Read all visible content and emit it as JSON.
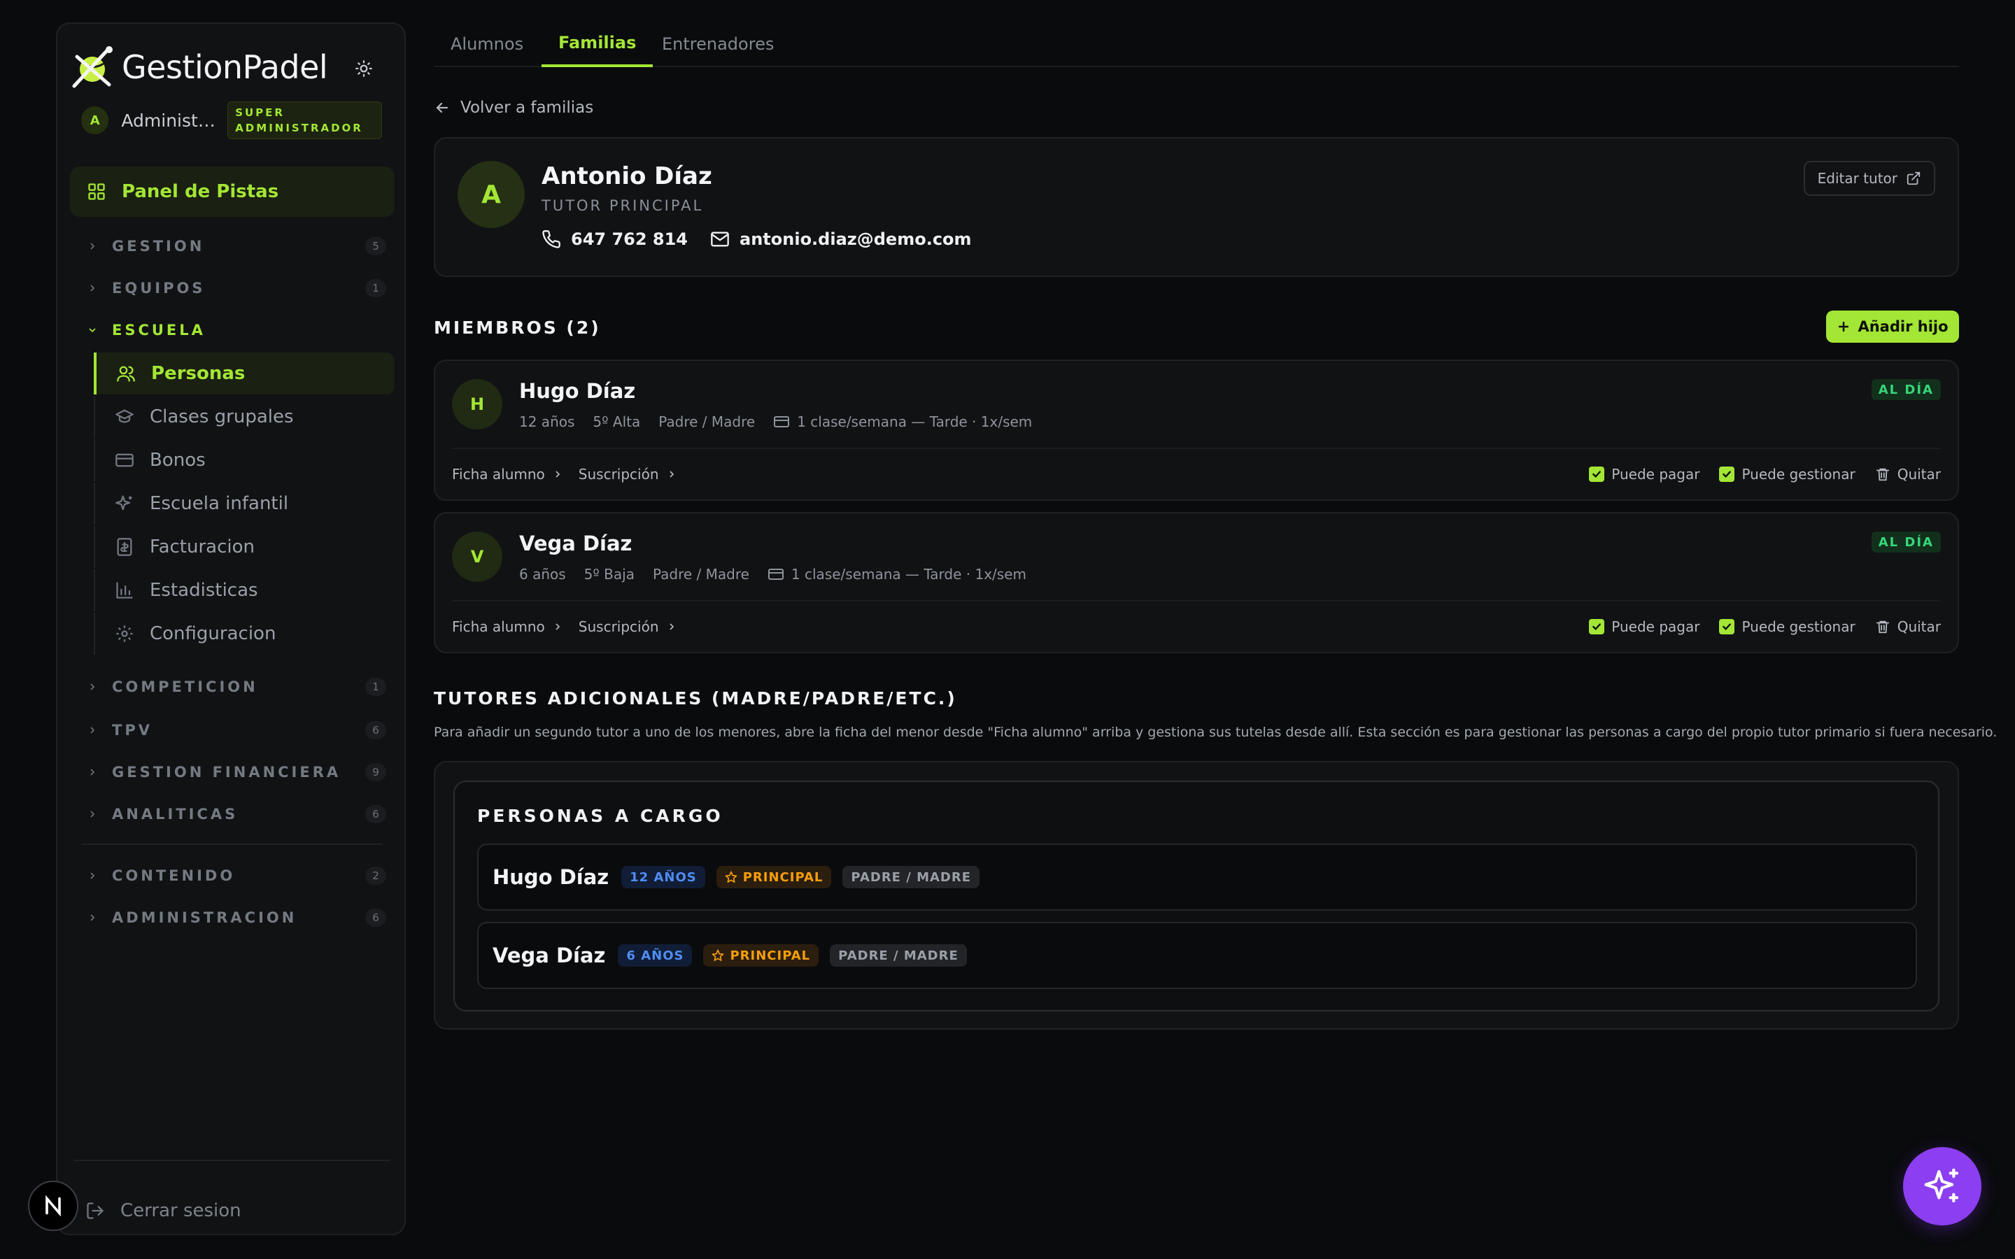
{
  "brand": {
    "name": "GestionPadel"
  },
  "user": {
    "avatar_letter": "A",
    "name": "Administrador",
    "role": "SUPER ADMINISTRADOR"
  },
  "sidebar": {
    "panel": "Panel de Pistas",
    "sections_top": [
      {
        "label": "GESTION",
        "count": "5"
      },
      {
        "label": "EQUIPOS",
        "count": "1"
      }
    ],
    "escuela": {
      "label": "ESCUELA",
      "items": [
        {
          "label": "Personas",
          "icon": "users-icon"
        },
        {
          "label": "Clases grupales",
          "icon": "graduation-cap-icon"
        },
        {
          "label": "Bonos",
          "icon": "credit-card-icon"
        },
        {
          "label": "Escuela infantil",
          "icon": "sparkles-icon"
        },
        {
          "label": "Facturacion",
          "icon": "invoice-icon"
        },
        {
          "label": "Estadisticas",
          "icon": "bar-chart-icon"
        },
        {
          "label": "Configuracion",
          "icon": "gear-icon"
        }
      ]
    },
    "sections_bottom": [
      {
        "label": "COMPETICION",
        "count": "1"
      },
      {
        "label": "TPV",
        "count": "6"
      },
      {
        "label": "GESTION FINANCIERA",
        "count": "9"
      },
      {
        "label": "ANALITICAS",
        "count": "6"
      }
    ],
    "sections_extra": [
      {
        "label": "CONTENIDO",
        "count": "2"
      },
      {
        "label": "ADMINISTRACION",
        "count": "6"
      }
    ],
    "logout": "Cerrar sesion"
  },
  "tabs": [
    {
      "label": "Alumnos"
    },
    {
      "label": "Familias"
    },
    {
      "label": "Entrenadores"
    }
  ],
  "back_link": "Volver a familias",
  "tutor": {
    "avatar_letter": "A",
    "name": "Antonio Díaz",
    "role": "TUTOR PRINCIPAL",
    "phone": "647 762 814",
    "email": "antonio.diaz@demo.com",
    "edit_label": "Editar tutor"
  },
  "members": {
    "title": "MIEMBROS (2)",
    "add_label": "Añadir hijo",
    "link_ficha": "Ficha alumno",
    "link_suscripcion": "Suscripción",
    "can_pay": "Puede pagar",
    "can_manage": "Puede gestionar",
    "remove": "Quitar",
    "items": [
      {
        "avatar_letter": "H",
        "name": "Hugo Díaz",
        "age": "12 años",
        "level": "5º Alta",
        "relation": "Padre / Madre",
        "plan": "1 clase/semana — Tarde · 1x/sem",
        "status": "AL DÍA"
      },
      {
        "avatar_letter": "V",
        "name": "Vega Díaz",
        "age": "6 años",
        "level": "5º Baja",
        "relation": "Padre / Madre",
        "plan": "1 clase/semana — Tarde · 1x/sem",
        "status": "AL DÍA"
      }
    ]
  },
  "additional": {
    "title": "TUTORES ADICIONALES (MADRE/PADRE/ETC.)",
    "note": "Para añadir un segundo tutor a uno de los menores, abre la ficha del menor desde \"Ficha alumno\" arriba y gestiona sus tutelas desde allí. Esta sección es para gestionar las personas a cargo del propio tutor primario si fuera necesario.",
    "box_title": "PERSONAS A CARGO",
    "dependents": [
      {
        "name": "Hugo Díaz",
        "age": "12 AÑOS",
        "principal": "PRINCIPAL",
        "relation": "PADRE / MADRE"
      },
      {
        "name": "Vega Díaz",
        "age": "6 AÑOS",
        "principal": "PRINCIPAL",
        "relation": "PADRE / MADRE"
      }
    ]
  },
  "colors": {
    "accent": "#a3e635",
    "background": "#0a0b0d",
    "status_ok": "#37d67a",
    "fab": "#8b3ff0"
  }
}
